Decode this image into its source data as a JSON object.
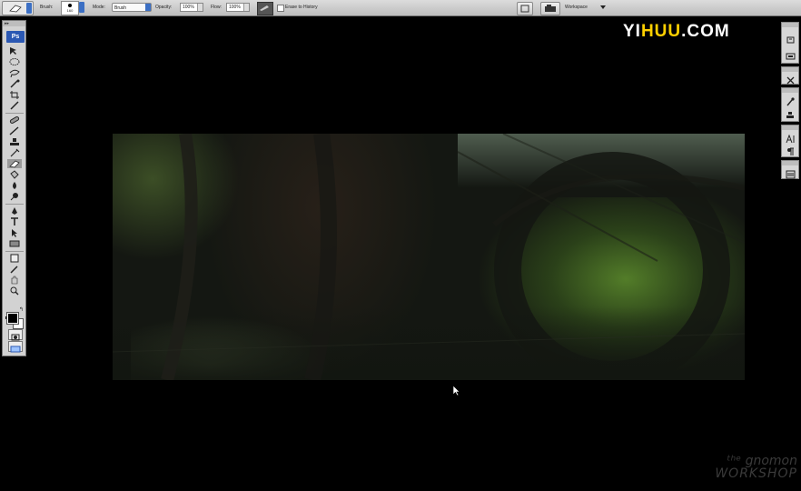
{
  "options_bar": {
    "brush_label": "Brush:",
    "brush_size": "160",
    "mode_label": "Mode:",
    "mode_value": "Brush",
    "opacity_label": "Opacity:",
    "opacity_value": "100%",
    "flow_label": "Flow:",
    "flow_value": "100%",
    "erase_to_history_label": "Erase to History",
    "workspace_label": "Workspace"
  },
  "toolbox": {
    "grip": "▸▸",
    "logo": "Ps"
  },
  "watermark": {
    "site_prefix": "YI",
    "site_highlight": "HUU",
    "site_suffix": ".COM",
    "brand_line1": "ᵗʰᵉ gnomon",
    "brand_line2": "WORKSHOP"
  },
  "colors": {
    "accent": "#3b6fc4",
    "logo_bg": "#2b58b3",
    "watermark_yellow": "#ffd000"
  }
}
